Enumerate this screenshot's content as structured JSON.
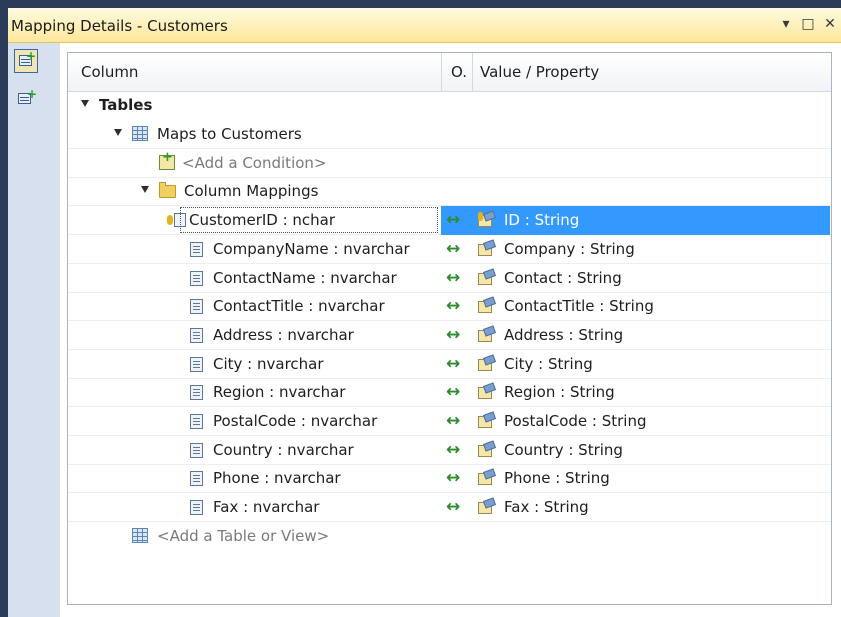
{
  "window": {
    "title": "Mapping Details - Customers",
    "buttons": [
      "▾",
      "□",
      "✕"
    ]
  },
  "toolbar": {
    "icons": [
      "map-entity-to-tables-icon",
      "map-entity-to-functions-icon"
    ]
  },
  "columns": {
    "column": "Column",
    "operator": "O.",
    "value": "Value / Property"
  },
  "tree": {
    "tables_label": "Tables",
    "maps_to": "Maps to Customers",
    "add_condition": "<Add a Condition>",
    "column_mappings": "Column Mappings",
    "add_table": "<Add a Table or View>"
  },
  "mappings": [
    {
      "column": "CustomerID : nchar",
      "operator": "↔",
      "property": "ID : String",
      "key": true,
      "selected": true
    },
    {
      "column": "CompanyName : nvarchar",
      "operator": "↔",
      "property": "Company : String"
    },
    {
      "column": "ContactName : nvarchar",
      "operator": "↔",
      "property": "Contact : String"
    },
    {
      "column": "ContactTitle : nvarchar",
      "operator": "↔",
      "property": "ContactTitle : String"
    },
    {
      "column": "Address : nvarchar",
      "operator": "↔",
      "property": "Address : String"
    },
    {
      "column": "City : nvarchar",
      "operator": "↔",
      "property": "City : String"
    },
    {
      "column": "Region : nvarchar",
      "operator": "↔",
      "property": "Region : String"
    },
    {
      "column": "PostalCode : nvarchar",
      "operator": "↔",
      "property": "PostalCode : String"
    },
    {
      "column": "Country : nvarchar",
      "operator": "↔",
      "property": "Country : String"
    },
    {
      "column": "Phone : nvarchar",
      "operator": "↔",
      "property": "Phone : String"
    },
    {
      "column": "Fax : nvarchar",
      "operator": "↔",
      "property": "Fax : String"
    }
  ],
  "colors": {
    "title_gradient_top": "#fffbe0",
    "title_gradient_bottom": "#ffe79a",
    "selection": "#3399ff",
    "frame": "#2b3c59",
    "arrow": "#2d8c2d"
  }
}
